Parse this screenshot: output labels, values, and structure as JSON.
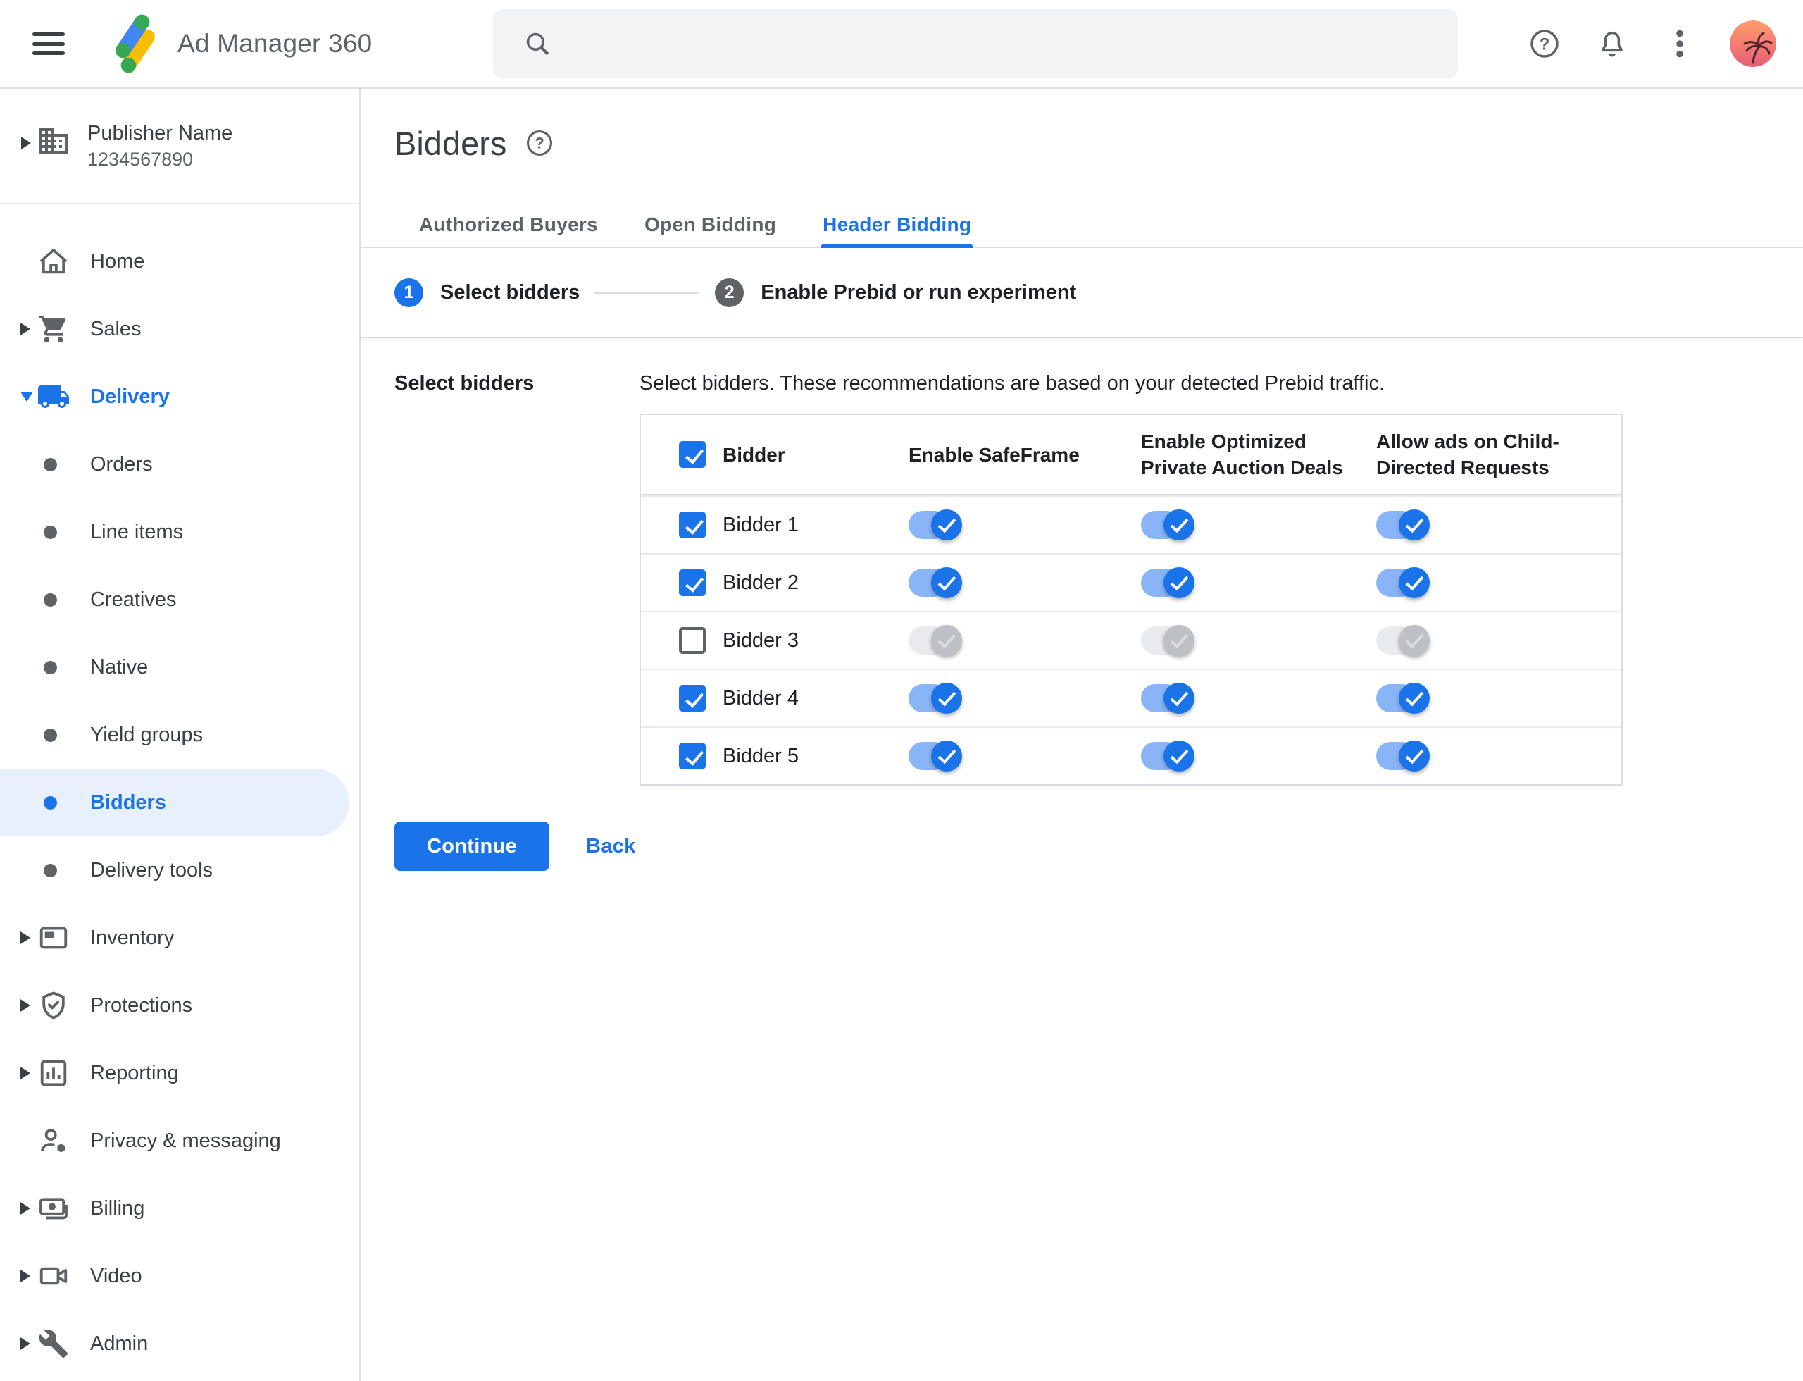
{
  "colors": {
    "accent": "#1a73e8",
    "accent_light": "#8ab4f8",
    "selected_bg": "#e8f0fe",
    "searchbar_bg": "#f1f3f4",
    "border": "#dadce0",
    "border_light": "#e8eaed",
    "disabled_track": "#e8eaed",
    "disabled_thumb": "#bdc1c6",
    "step2_bg": "#5f6368",
    "avatar_top": "#ff9d6e",
    "avatar_bottom": "#e85d75"
  },
  "topbar": {
    "product_title": "Ad Manager 360",
    "icons": [
      "menu-icon",
      "ad-manager-logo",
      "search-icon",
      "help-icon",
      "notifications-bell-icon",
      "more-vert-icon",
      "avatar"
    ],
    "search": {
      "value": "",
      "placeholder": ""
    }
  },
  "sidebar": {
    "publisher": {
      "name": "Publisher Name",
      "id": "1234567890",
      "icon": "building-icon"
    },
    "items": [
      {
        "label": "Home",
        "icon": "home-icon",
        "caret": "none"
      },
      {
        "label": "Sales",
        "icon": "cart-icon",
        "caret": "right"
      },
      {
        "label": "Delivery",
        "icon": "truck-icon",
        "caret": "down",
        "expanded": true
      },
      {
        "label": "Orders",
        "icon": "bullet-icon"
      },
      {
        "label": "Line items",
        "icon": "bullet-icon"
      },
      {
        "label": "Creatives",
        "icon": "bullet-icon"
      },
      {
        "label": "Native",
        "icon": "bullet-icon"
      },
      {
        "label": "Yield groups",
        "icon": "bullet-icon"
      },
      {
        "label": "Bidders",
        "icon": "bullet-icon",
        "selected": true
      },
      {
        "label": "Delivery tools",
        "icon": "bullet-icon"
      },
      {
        "label": "Inventory",
        "icon": "inventory-icon",
        "caret": "right"
      },
      {
        "label": "Protections",
        "icon": "shield-icon",
        "caret": "right"
      },
      {
        "label": "Reporting",
        "icon": "chart-icon",
        "caret": "right"
      },
      {
        "label": "Privacy & messaging",
        "icon": "person-badge-icon",
        "caret": "none"
      },
      {
        "label": "Billing",
        "icon": "payments-icon",
        "caret": "right"
      },
      {
        "label": "Video",
        "icon": "videocam-icon",
        "caret": "right"
      },
      {
        "label": "Admin",
        "icon": "wrench-icon",
        "caret": "right"
      }
    ]
  },
  "main": {
    "page_title": "Bidders",
    "help_icon": "help-icon",
    "tabs": [
      {
        "label": "Authorized Buyers",
        "active": false
      },
      {
        "label": "Open Bidding",
        "active": false
      },
      {
        "label": "Header Bidding",
        "active": true
      }
    ],
    "stepper": {
      "steps": [
        {
          "number": "1",
          "label": "Select bidders",
          "state": "active"
        },
        {
          "number": "2",
          "label": "Enable Prebid or run experiment",
          "state": "upcoming"
        }
      ]
    },
    "section_label": "Select bidders",
    "description": "Select bidders. These recommendations are based on your detected Prebid traffic.",
    "table": {
      "select_all_checked": true,
      "columns": [
        "Bidder",
        "Enable SafeFrame",
        "Enable Optimized Private Auction Deals",
        "Allow ads on Child-Directed Requests"
      ],
      "rows": [
        {
          "name": "Bidder 1",
          "selected": true,
          "safeframe": true,
          "optimized_deals": true,
          "child_directed": true
        },
        {
          "name": "Bidder 2",
          "selected": true,
          "safeframe": true,
          "optimized_deals": true,
          "child_directed": true
        },
        {
          "name": "Bidder 3",
          "selected": false,
          "safeframe": false,
          "optimized_deals": false,
          "child_directed": false
        },
        {
          "name": "Bidder 4",
          "selected": true,
          "safeframe": true,
          "optimized_deals": true,
          "child_directed": true
        },
        {
          "name": "Bidder 5",
          "selected": true,
          "safeframe": true,
          "optimized_deals": true,
          "child_directed": true
        }
      ]
    },
    "actions": {
      "continue_label": "Continue",
      "back_label": "Back"
    }
  }
}
